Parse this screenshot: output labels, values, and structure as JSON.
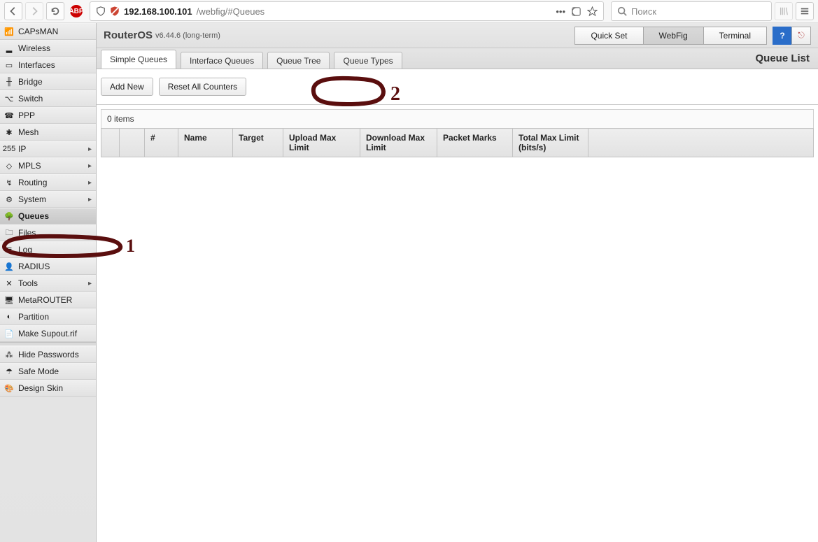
{
  "browser": {
    "url_ip": "192.168.100.101",
    "url_path": "/webfig/#Queues",
    "search_placeholder": "Поиск",
    "dots": "•••"
  },
  "sidebar": {
    "items": [
      {
        "label": "CAPsMAN",
        "icon": "📶",
        "expandable": false
      },
      {
        "label": "Wireless",
        "icon": "▂",
        "expandable": false
      },
      {
        "label": "Interfaces",
        "icon": "▭",
        "expandable": false
      },
      {
        "label": "Bridge",
        "icon": "╫",
        "expandable": false
      },
      {
        "label": "Switch",
        "icon": "⌥",
        "expandable": false
      },
      {
        "label": "PPP",
        "icon": "☎",
        "expandable": false
      },
      {
        "label": "Mesh",
        "icon": "✱",
        "expandable": false
      },
      {
        "label": "IP",
        "icon": "255",
        "expandable": true
      },
      {
        "label": "MPLS",
        "icon": "◇",
        "expandable": true
      },
      {
        "label": "Routing",
        "icon": "↯",
        "expandable": true
      },
      {
        "label": "System",
        "icon": "⚙",
        "expandable": true
      },
      {
        "label": "Queues",
        "icon": "🌳",
        "expandable": false,
        "active": true
      },
      {
        "label": "Files",
        "icon": "🗀",
        "expandable": false
      },
      {
        "label": "Log",
        "icon": "≣",
        "expandable": false
      },
      {
        "label": "RADIUS",
        "icon": "👤",
        "expandable": false
      },
      {
        "label": "Tools",
        "icon": "✕",
        "expandable": true
      },
      {
        "label": "MetaROUTER",
        "icon": "🖥",
        "expandable": false
      },
      {
        "label": "Partition",
        "icon": "◐",
        "expandable": false
      },
      {
        "label": "Make Supout.rif",
        "icon": "📄",
        "expandable": false
      }
    ],
    "bottom": [
      {
        "label": "Hide Passwords",
        "icon": "⁂"
      },
      {
        "label": "Safe Mode",
        "icon": "☂"
      },
      {
        "label": "Design Skin",
        "icon": "🎨"
      }
    ]
  },
  "header": {
    "brand": "RouterOS",
    "version": "v6.44.6 (long-term)",
    "buttons": {
      "quickset": "Quick Set",
      "webfig": "WebFig",
      "terminal": "Terminal"
    }
  },
  "tabs": [
    {
      "label": "Simple Queues",
      "active": true
    },
    {
      "label": "Interface Queues",
      "active": false
    },
    {
      "label": "Queue Tree",
      "active": false
    },
    {
      "label": "Queue Types",
      "active": false
    }
  ],
  "page_title": "Queue List",
  "toolbar": {
    "add_new": "Add New",
    "reset": "Reset All Counters"
  },
  "table": {
    "count": "0 items",
    "columns": [
      "",
      "",
      "#",
      "Name",
      "Target",
      "Upload Max Limit",
      "Download Max Limit",
      "Packet Marks",
      "Total Max Limit (bits/s)",
      ""
    ],
    "col_widths": [
      "26",
      "36",
      "48",
      "78",
      "72",
      "110",
      "110",
      "108",
      "108",
      ""
    ]
  },
  "annotations": {
    "one": "1",
    "two": "2"
  }
}
